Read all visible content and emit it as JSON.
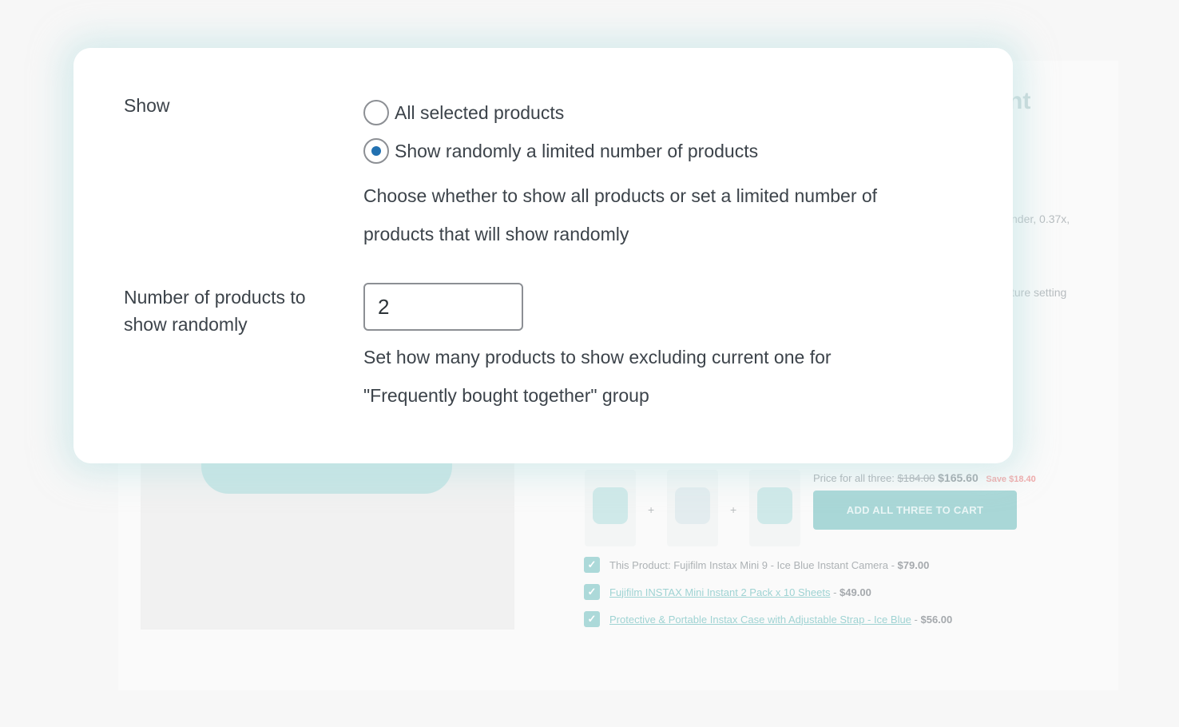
{
  "background_page": {
    "title_fragment": "nt",
    "desc_fragment_1": "nder, 0.37x,",
    "desc_fragment_2": "ture setting",
    "bundle": {
      "price_label": "Price for all three:",
      "old_price": "$184.00",
      "new_price": "$165.60",
      "save_text": "Save $18.40",
      "add_button_label": "ADD ALL THREE TO CART",
      "plus_symbol": "+",
      "items": [
        {
          "prefix": "This Product: ",
          "name": "Fujifilm Instax Mini 9 - Ice Blue Instant Camera",
          "price": "$79.00",
          "linked": false
        },
        {
          "prefix": "",
          "name": "Fujifilm INSTAX Mini Instant 2 Pack x 10 Sheets",
          "price": "$49.00",
          "linked": true
        },
        {
          "prefix": "",
          "name": "Protective & Portable Instax Case with Adjustable Strap - Ice Blue",
          "price": "$56.00",
          "linked": true
        }
      ],
      "separator": " - ",
      "checkmark_icon": "✓"
    }
  },
  "modal": {
    "show_label": "Show",
    "options": [
      {
        "label": "All selected products",
        "checked": false
      },
      {
        "label": "Show randomly a limited number of products",
        "checked": true
      }
    ],
    "show_help_line1": "Choose whether to show all products or set a limited number of",
    "show_help_line2": "products that will show randomly",
    "count_label_line1": "Number of products to",
    "count_label_line2": "show randomly",
    "count_value": "2",
    "count_help_line1": "Set how many products to show excluding current one for",
    "count_help_line2": "\"Frequently bought together\" group"
  },
  "colors": {
    "radio_selected": "#2271b1",
    "accent_teal": "#a9d7d7",
    "sale_red": "#f0a9a9"
  }
}
